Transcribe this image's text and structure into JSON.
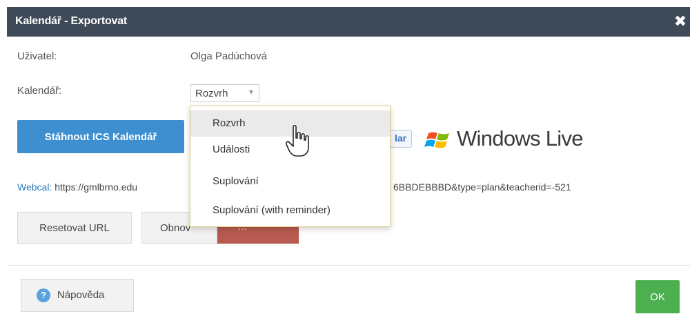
{
  "dialog": {
    "title": "Kalendář - Exportovat",
    "close_glyph": "✖"
  },
  "form": {
    "user_label": "Uživatel:",
    "user_value": "Olga Padúchová",
    "calendar_label": "Kalendář:",
    "calendar_selected": "Rozvrh",
    "calendar_options": [
      "Rozvrh",
      "Události",
      "Suplování",
      "Suplování (with reminder)"
    ]
  },
  "actions": {
    "download_ics": "Stáhnout ICS Kalendář",
    "google_fragment": "lar",
    "windows_live": "Windows Live"
  },
  "webcal": {
    "label": "Webcal:",
    "url_visible": "https://gmlbrno.edu",
    "url_tail": "6BBDEBBBD&type=plan&teacherid=-521"
  },
  "buttons": {
    "reset_url": "Resetovat URL",
    "refresh_fragment": "Obnov",
    "delete_fragment": "..."
  },
  "footer": {
    "help": "Nápověda",
    "help_icon_glyph": "?",
    "ok": "OK"
  },
  "colors": {
    "titlebar": "#3e4a57",
    "primary": "#3d8fd0",
    "ok": "#4caf50",
    "danger": "#b85a50"
  }
}
